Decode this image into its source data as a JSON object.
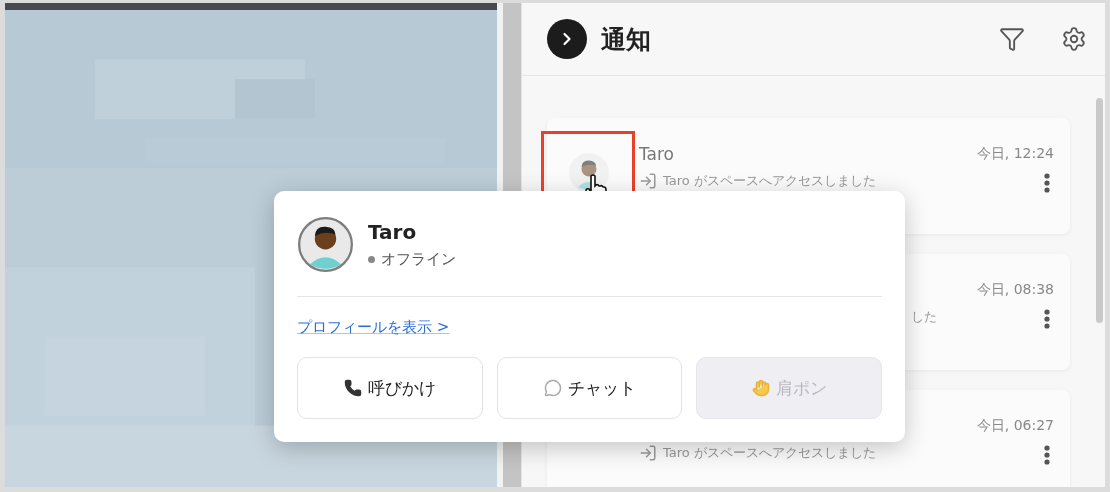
{
  "panel": {
    "title": "通知"
  },
  "notifications": [
    {
      "name": "Taro",
      "time": "今日, 12:24",
      "message": "Taro がスペースへアクセスしました",
      "avatar_visible": true,
      "clipped_start": false
    },
    {
      "time": "今日, 08:38",
      "message": "した",
      "avatar_visible": false,
      "clipped_start": true
    },
    {
      "time": "今日, 06:27",
      "message": "Taro がスペースへアクセスしました",
      "avatar_visible": false,
      "clipped_start": false
    }
  ],
  "popup": {
    "name": "Taro",
    "status": "オフライン",
    "profile_link": "プロフィールを表示 >",
    "buttons": [
      {
        "kind": "call",
        "label": "呼びかけ",
        "disabled": false
      },
      {
        "kind": "chat",
        "label": "チャット",
        "disabled": false
      },
      {
        "kind": "wave",
        "label": "肩ポン",
        "disabled": true
      }
    ]
  }
}
